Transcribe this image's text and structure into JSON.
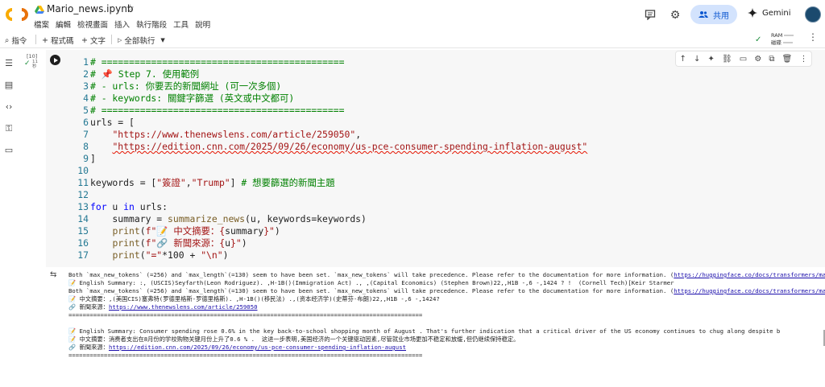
{
  "app": {
    "title": "Mario_news.ipynb",
    "menu": [
      "檔案",
      "編輯",
      "檢視畫面",
      "插入",
      "執行階段",
      "工具",
      "說明"
    ],
    "share_label": "共用",
    "gemini_label": "Gemini"
  },
  "toolbar": {
    "commands_label": "指令",
    "code_label": "程式碼",
    "text_label": "文字",
    "run_all_label": "全部執行",
    "ram_label": "RAM",
    "disk_label": "磁碟"
  },
  "cell": {
    "execution_count": "[10]",
    "exec_time": [
      "11",
      "秒"
    ],
    "lines": [
      [
        [
          "cm",
          "# ============================================"
        ]
      ],
      [
        [
          "cm",
          "# 📌 Step 7. 使用範例"
        ]
      ],
      [
        [
          "cm",
          "# - urls: 你要丟的新聞網址 (可一次多個)"
        ]
      ],
      [
        [
          "cm",
          "# - keywords: 關鍵字篩選 (英文或中文都可)"
        ]
      ],
      [
        [
          "cm",
          "# ============================================"
        ]
      ],
      [
        [
          "txt",
          "urls = ["
        ]
      ],
      [
        [
          "txt",
          "    "
        ],
        [
          "str",
          "\"https://www.thenewslens.com/article/259050\""
        ],
        [
          "txt",
          ","
        ]
      ],
      [
        [
          "txt",
          "    "
        ],
        [
          "str squig",
          "\"https://edition.cnn.com/2025/09/26/economy/us-pce-consumer-spending-inflation-august\""
        ]
      ],
      [
        [
          "txt",
          "]"
        ]
      ],
      [
        [
          "txt",
          ""
        ]
      ],
      [
        [
          "txt",
          "keywords = ["
        ],
        [
          "str",
          "\"簽證\""
        ],
        [
          "txt",
          ","
        ],
        [
          "str",
          "\"Trump\""
        ],
        [
          "txt",
          "] "
        ],
        [
          "cm",
          "# 想要篩選的新聞主題"
        ]
      ],
      [
        [
          "txt",
          ""
        ]
      ],
      [
        [
          "kw",
          "for"
        ],
        [
          "txt",
          " u "
        ],
        [
          "kw",
          "in"
        ],
        [
          "txt",
          " urls:"
        ]
      ],
      [
        [
          "txt",
          "    summary = "
        ],
        [
          "fn",
          "summarize_news"
        ],
        [
          "txt",
          "(u, keywords=keywords)"
        ]
      ],
      [
        [
          "txt",
          "    "
        ],
        [
          "fn",
          "print"
        ],
        [
          "txt",
          "("
        ],
        [
          "str",
          "f\"📝 中文摘要：{"
        ],
        [
          "txt",
          "summary"
        ],
        [
          "str",
          "}\""
        ],
        [
          "txt",
          ")"
        ]
      ],
      [
        [
          "txt",
          "    "
        ],
        [
          "fn",
          "print"
        ],
        [
          "txt",
          "("
        ],
        [
          "str",
          "f\"🔗 新聞來源：{"
        ],
        [
          "txt",
          "u"
        ],
        [
          "str",
          "}\""
        ],
        [
          "txt",
          ")"
        ]
      ],
      [
        [
          "txt",
          "    "
        ],
        [
          "fn",
          "print"
        ],
        [
          "txt",
          "("
        ],
        [
          "str",
          "\"=\""
        ],
        [
          "txt",
          "*100 + "
        ],
        [
          "str",
          "\"\\n\""
        ],
        [
          "txt",
          ")"
        ]
      ]
    ]
  },
  "output": {
    "lines": [
      {
        "text": "Both `max_new_tokens` (=256) and `max_length`(=130) seem to have been set. `max_new_tokens` will take precedence. Please refer to the documentation for more information. (",
        "link": "https://huggingface.co/docs/transformers/main/en/main_classes/text_generation"
      },
      {
        "text": "📝 English Summary: :, (USCIS)Seyfarth(Leon Rodriguez). ,H-1B()(Immigration Act) ., ,(Capital Economics) (Stephen Brown)22,,H1B -,6 -,1424 ? !  (Cornell Tech)[Keir Starmer"
      },
      {
        "text": "Both `max_new_tokens` (=256) and `max_length`(=130) seem to have been set. `max_new_tokens` will take precedence. Please refer to the documentation for more information. (",
        "link": "https://huggingface.co/docs/transformers/main/en/main_classes/text_generation"
      },
      {
        "text": "📝 中文摘要：,(美国CIS)塞弗特(罗德里格斯-罗德里格斯). ,H-1B()(移民法) .,(资本经济学)(史蒂芬·布朗)22,,H1B -,6 -,1424?"
      },
      {
        "text": "🔗 新聞來源：",
        "link": "https://www.thenewslens.com/article/259050"
      },
      {
        "text": "===================================================================================================="
      },
      {
        "text": ""
      },
      {
        "text": "📝 English Summary: Consumer spending rose 0.6% in the key back-to-school shopping month of August . That's further indication that a critical driver of the US economy continues to chug along despite b"
      },
      {
        "text": "📝 中文摘要：消费者支出在8月份的学校购物关键月份上升了0.6 % .  这进一步表明,美国经济的一个关键驱动因素,尽管就业市场更加不稳定和放缓,但仍继续保持稳定。"
      },
      {
        "text": "🔗 新聞來源：",
        "link": "https://edition.cnn.com/2025/09/26/economy/us-pce-consumer-spending-inflation-august"
      },
      {
        "text": "===================================================================================================="
      }
    ]
  },
  "colors": {
    "share_bg": "#d3e3fd",
    "share_text": "#0b57d0",
    "cell_bg": "#f7f7f7",
    "link": "#1a0dab",
    "comment": "#008000",
    "string": "#a31515",
    "keyword": "#0000ff"
  }
}
